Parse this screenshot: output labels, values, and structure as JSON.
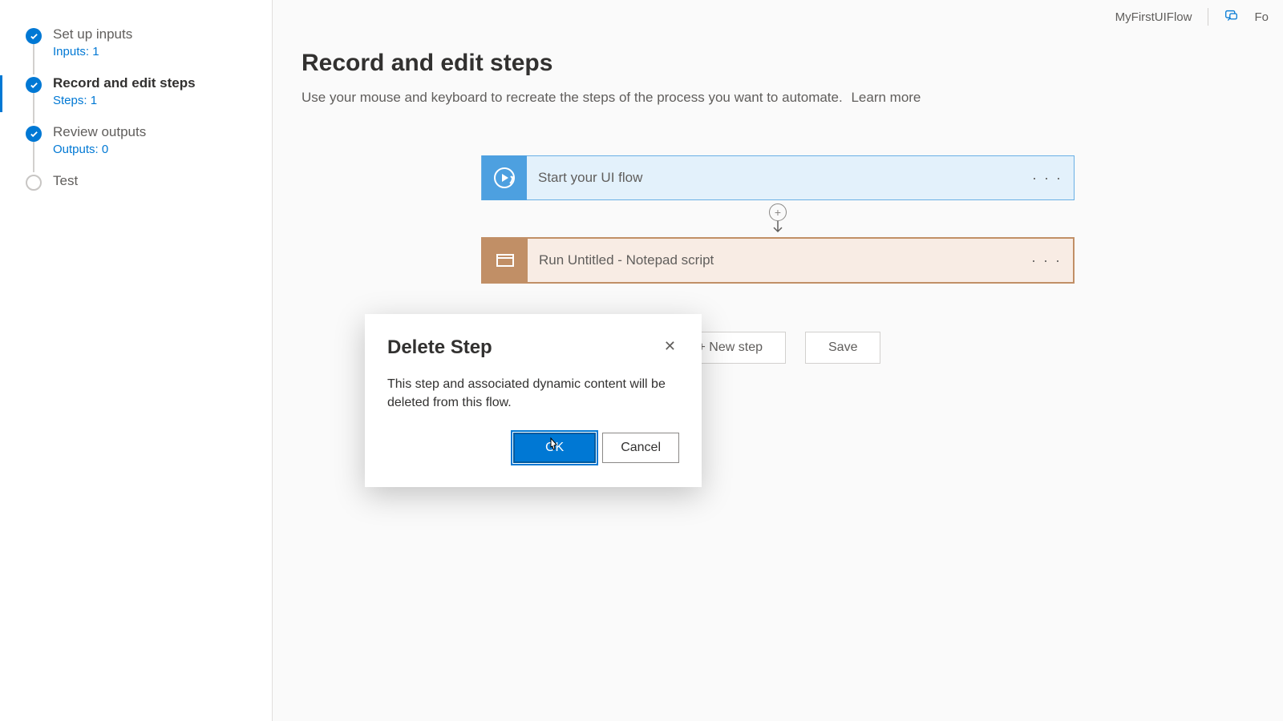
{
  "header": {
    "flow_name": "MyFirstUIFlow",
    "right_cut": "Fo"
  },
  "sidebar": {
    "items": [
      {
        "title": "Set up inputs",
        "sub": "Inputs: 1",
        "done": true
      },
      {
        "title": "Record and edit steps",
        "sub": "Steps: 1",
        "done": true,
        "active": true
      },
      {
        "title": "Review outputs",
        "sub": "Outputs: 0",
        "done": true
      },
      {
        "title": "Test",
        "sub": "",
        "done": false
      }
    ]
  },
  "main": {
    "title": "Record and edit steps",
    "description": "Use your mouse and keyboard to recreate the steps of the process you want to automate.",
    "learn_more": "Learn more",
    "new_step": "+ New step",
    "save": "Save"
  },
  "cards": {
    "start": "Start your UI flow",
    "script": "Run Untitled - Notepad script"
  },
  "dialog": {
    "title": "Delete Step",
    "body": "This step and associated dynamic content will be deleted from this flow.",
    "ok": "OK",
    "cancel": "Cancel"
  }
}
